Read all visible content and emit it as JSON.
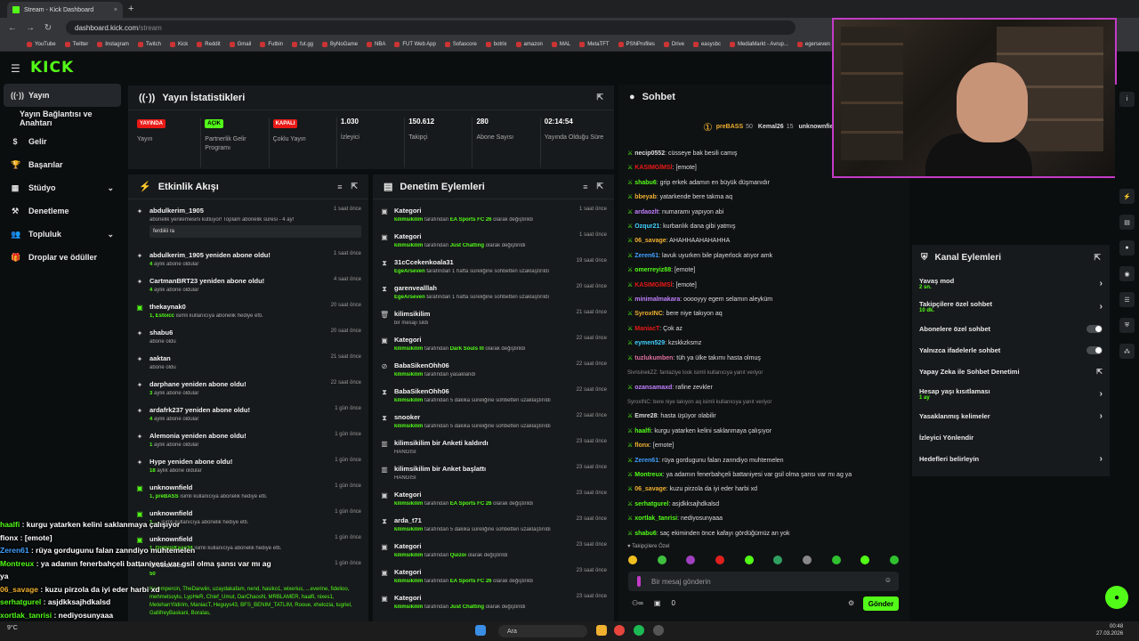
{
  "browser": {
    "tab_title": "Stream - Kick Dashboard",
    "new_tab": "+",
    "url_host": "dashboard.kick.com",
    "url_path": "/stream",
    "bookmarks": [
      "YouTube",
      "Twitter",
      "Instagram",
      "Twitch",
      "Kick",
      "Reddit",
      "Gmail",
      "Futbin",
      "fut.gg",
      "ByNoGame",
      "NBA",
      "FUT Web App",
      "Sofascore",
      "botrix",
      "amazon",
      "MAL",
      "MetaTFT",
      "PSNProfiles",
      "Drive",
      "easysbc",
      "MediaMarkt - Avrup...",
      "egerseven"
    ]
  },
  "brand": {
    "logo": "KICK",
    "accent": "#53fc18"
  },
  "leftnav": {
    "items": [
      {
        "label": "Yayın",
        "icon": "broadcast-icon"
      },
      {
        "label": "Yayın Bağlantısı ve Anahtarı"
      },
      {
        "label": "Gelir",
        "icon": "revenue-icon"
      },
      {
        "label": "Başarılar",
        "icon": "trophy-icon"
      },
      {
        "label": "Stüdyo",
        "icon": "studio-icon"
      },
      {
        "label": "Denetleme",
        "icon": "moderation-icon"
      },
      {
        "label": "Topluluk",
        "icon": "community-icon"
      },
      {
        "label": "Droplar ve ödüller",
        "icon": "gift-icon"
      }
    ]
  },
  "stats": {
    "title": "Yayın İstatistikleri",
    "cells": [
      {
        "badge": "YAYINDA",
        "label": "Yayın"
      },
      {
        "badge": "AÇIK",
        "label": "Partnerlik Gelir Programı"
      },
      {
        "badge": "KAPALI",
        "label": "Çoklu Yayın"
      },
      {
        "value": "1.030",
        "label": "İzleyici"
      },
      {
        "value": "150.612",
        "label": "Takipçi"
      },
      {
        "value": "280",
        "label": "Abone Sayısı"
      },
      {
        "value": "02:14:54",
        "label": "Yayında Olduğu Süre"
      }
    ]
  },
  "activity": {
    "title": "Etkinlik Akışı",
    "items": [
      {
        "title": "abdulkerim_1905",
        "time": "1 saat önce",
        "sub": "abonelik yenilemesini kutluyor! Toplam abonelik süresi - 4 ay!",
        "quote": "ferdiiiii ra"
      },
      {
        "title": "abdulkerim_1905 yeniden abone oldu!",
        "time": "1 saat önce",
        "subg": "4",
        "sub": " aylık abone oldular"
      },
      {
        "title": "CartmanBRT23 yeniden abone oldu!",
        "time": "4 saat önce",
        "subg": "4",
        "sub": " aylık abone oldular"
      },
      {
        "title": "thekaynak0",
        "time": "20 saat önce",
        "subg": "1, Estoicc",
        "sub": " isimli kullanıcıya abonelik hediye etti.",
        "gift": true
      },
      {
        "title": "shabu6",
        "time": "20 saat önce",
        "sub": "abone oldu"
      },
      {
        "title": "aaktan",
        "time": "21 saat önce",
        "sub": "abone oldu"
      },
      {
        "title": "darphane yeniden abone oldu!",
        "time": "22 saat önce",
        "subg": "3",
        "sub": " aylık abone oldular"
      },
      {
        "title": "ardafrk237 yeniden abone oldu!",
        "time": "1 gün önce",
        "subg": "4",
        "sub": " aylık abone oldular"
      },
      {
        "title": "Alemonia yeniden abone oldu!",
        "time": "1 gün önce",
        "subg": "1",
        "sub": " aylık abone oldular"
      },
      {
        "title": "Hype yeniden abone oldu!",
        "time": "1 gün önce",
        "subg": "18",
        "sub": " aylık abone oldular"
      },
      {
        "title": "unknownfield",
        "time": "1 gün önce",
        "subg": "1, preBASS",
        "sub": " isimli kullanıcıya abonelik hediye etti.",
        "gift": true
      },
      {
        "title": "unknownfield",
        "time": "1 gün önce",
        "subg": "1, ...",
        "sub": " isimli kullanıcıya abonelik hediye etti.",
        "gift": true
      },
      {
        "title": "unknownfield",
        "time": "1 gün önce",
        "subg": "1, GümüşKaan34",
        "sub": " isimli kullanıcıya abonelik hediye etti.",
        "gift": true
      },
      {
        "title": "ProBasser",
        "time": "1 gün önce",
        "subg": "50",
        "sub": ""
      }
    ],
    "gift_list": "Kerempercin, TheDarwiin, uzaydakafam, nend, hasiko1, wixerius, ...everine, fidelioo, mehmetsoylu, LypHeR, Chief_Umut, DarChaosN, MRBLAMER, haalfi, nixes1, MetehanYildirim, ManiacT, Heguys43, BFS_BENIM_TATLIM, Rooue, xhelozia, tugriel, GallifreyBaskani, Boralas,"
  },
  "moderation": {
    "title": "Denetim Eylemleri",
    "items": [
      {
        "icon": "category-icon",
        "title": "Kategori",
        "time": "1 saat önce",
        "mod": "kilimsikilim",
        "text": " tarafından ",
        "target": "EA Sports FC 26",
        "tail": " olarak değiştirildi"
      },
      {
        "icon": "category-icon",
        "title": "Kategori",
        "time": "1 saat önce",
        "mod": "kilimsikilim",
        "text": " tarafından ",
        "target": "Just Chatting",
        "tail": " olarak değiştirildi"
      },
      {
        "icon": "timeout-icon",
        "title": "31cCcekenkoala31",
        "time": "19 saat önce",
        "mod": "EgeArseven",
        "text": " tarafından 1 hafta süreliğine sohbetten uzaklaştırıldı"
      },
      {
        "icon": "timeout-icon",
        "title": "garenvealllah",
        "time": "20 saat önce",
        "mod": "EgeArseven",
        "text": " tarafından 1 hafta süreliğine sohbetten uzaklaştırıldı"
      },
      {
        "icon": "trash-icon",
        "title": "kilimsikilim",
        "time": "21 saat önce",
        "text": "bir mesajı sildi"
      },
      {
        "icon": "category-icon",
        "title": "Kategori",
        "time": "22 saat önce",
        "mod": "kilimsikilim",
        "text": " tarafından ",
        "target": "Dark Souls III",
        "tail": " olarak değiştirildi"
      },
      {
        "icon": "ban-icon",
        "title": "BabaSikenOhh06",
        "time": "22 saat önce",
        "mod": "kilimsikilim",
        "text": " tarafından yasaklandı"
      },
      {
        "icon": "timeout-icon",
        "title": "BabaSikenOhh06",
        "time": "22 saat önce",
        "mod": "kilimsikilim",
        "text": " tarafından 5 dakika süreliğine sohbetten uzaklaştırıldı"
      },
      {
        "icon": "timeout-icon",
        "title": "snooker",
        "time": "22 saat önce",
        "mod": "kilimsikilim",
        "text": " tarafından 5 dakika süreliğine sohbetten uzaklaştırıldı"
      },
      {
        "icon": "poll-icon",
        "title": "kilimsikilim bir Anketi kaldırdı",
        "time": "23 saat önce",
        "text": "HANGİSİ"
      },
      {
        "icon": "poll-icon",
        "title": "kilimsikilim bir Anket başlattı",
        "time": "23 saat önce",
        "text": "HANGİSİ"
      },
      {
        "icon": "category-icon",
        "title": "Kategori",
        "time": "23 saat önce",
        "mod": "kilimsikilim",
        "text": " tarafından ",
        "target": "EA Sports FC 26",
        "tail": " olarak değiştirildi"
      },
      {
        "icon": "timeout-icon",
        "title": "arda_t71",
        "time": "23 saat önce",
        "mod": "kilimsikilim",
        "text": " tarafından 5 dakika süreliğine sohbetten uzaklaştırıldı"
      },
      {
        "icon": "category-icon",
        "title": "Kategori",
        "time": "23 saat önce",
        "mod": "kilimsikilim",
        "text": " tarafından ",
        "target": "Quizoi",
        "tail": " olarak değiştirildi"
      },
      {
        "icon": "category-icon",
        "title": "Kategori",
        "time": "23 saat önce",
        "mod": "kilimsikilim",
        "text": " tarafından ",
        "target": "EA Sports FC 26",
        "tail": " olarak değiştirildi"
      },
      {
        "icon": "category-icon",
        "title": "Kategori",
        "time": "23 saat önce",
        "mod": "kilimsikilim",
        "text": " tarafından ",
        "target": "Just Chatting",
        "tail": " olarak değiştirildi"
      }
    ]
  },
  "chat": {
    "title": "Sohbet",
    "pinned": [
      {
        "name": "preBASS",
        "count": "50"
      },
      {
        "name": "Kemal26",
        "count": "15"
      },
      {
        "name": "unknownfield",
        "count": "5"
      }
    ],
    "messages": [
      {
        "user": "necip0552",
        "color": "#ddd",
        "text": "cüsseye bak besili camış"
      },
      {
        "user": "KASIMGİMSİ",
        "color": "#e91916",
        "text": "[emote]"
      },
      {
        "user": "shabu6",
        "color": "#53fc18",
        "text": "grip erkek adamın en büyük düşmanıdır"
      },
      {
        "user": "bbeyab",
        "color": "#f0b030",
        "text": "yatarkende bere takma aq"
      },
      {
        "user": "ardaozlt",
        "color": "#c080ff",
        "text": "numaramı yapıyon abi"
      },
      {
        "user": "Ozqur21",
        "color": "#40d0ff",
        "text": "kurbanlık dana gibi yatmış"
      },
      {
        "user": "06_savage",
        "color": "#f0b030",
        "text": "AHAHHAAHAHAHHA"
      },
      {
        "user": "Zeren61",
        "color": "#40a0ff",
        "text": "lavuk uyurken bile playerlock atıyor amk"
      },
      {
        "user": "omerreyiz88",
        "color": "#53fc18",
        "text": "[emote]"
      },
      {
        "user": "KASIMGİMSİ",
        "color": "#e91916",
        "text": "[emote]"
      },
      {
        "user": "minimalmakara",
        "color": "#c080ff",
        "text": "ooooyyy egem selamın aleyküm"
      },
      {
        "user": "SyroxINC",
        "color": "#f0b030",
        "text": "bere niye takıyon aq"
      },
      {
        "user": "ManiacT",
        "color": "#e91916",
        "text": "Çok az"
      },
      {
        "user": "eymen529",
        "color": "#40d0ff",
        "text": "kzskkzksmz"
      },
      {
        "user": "tuzlukumben",
        "color": "#e070a0",
        "text": "tüh ya ülke takımı hasta olmuş"
      },
      {
        "user": "",
        "color": "#888",
        "text": "SivrisinekZZ: fantaziye look isimli kullanıcıya yanıt veriyor",
        "sys": true
      },
      {
        "user": "ozansamaxd",
        "color": "#c080ff",
        "text": "rafine zevkler"
      },
      {
        "user": "",
        "color": "#888",
        "text": "SyroxINC: bere niye takıyon aq isimli kullanıcıya yanıt veriyor",
        "sys": true
      },
      {
        "user": "Emre28",
        "color": "#ddd",
        "text": "hasta üşüyor olabilir"
      },
      {
        "user": "haalfi",
        "color": "#53fc18",
        "text": "kurgu yatarken kelini saklanmaya çalışıyor"
      },
      {
        "user": "flonx",
        "color": "#f0b030",
        "text": "[emote]"
      },
      {
        "user": "Zeren61",
        "color": "#40a0ff",
        "text": "rüya gordugunu falan zanndiyo muhtemelen"
      },
      {
        "user": "Montreux",
        "color": "#53fc18",
        "text": "ya adamın fenerbahçeli battaniyesi var gsil olma şansı var mı ag ya"
      },
      {
        "user": "06_savage",
        "color": "#f0b030",
        "text": "kuzu pirzola da iyi eder harbi xd"
      },
      {
        "user": "serhatgurel",
        "color": "#53fc18",
        "text": "asjdkksajhdkalsd"
      },
      {
        "user": "xortlak_tanrisi",
        "color": "#53fc18",
        "text": "nediyosunyaaa"
      },
      {
        "user": "shabu6",
        "color": "#53fc18",
        "text": "saç ekiminden önce kafayı gördüğümüz an yok"
      }
    ],
    "followers_only": "Takipçilere Özel",
    "input_placeholder": "Bir mesaj gönderin",
    "send_label": "Gönder",
    "counter": "0"
  },
  "channel_actions": {
    "title": "Kanal Eylemleri",
    "rows": [
      {
        "label": "Yavaş mod",
        "sub": "2 sn.",
        "type": "chevron"
      },
      {
        "label": "Takipçilere özel sohbet",
        "sub": "10 dk.",
        "type": "chevron"
      },
      {
        "label": "Abonelere özel sohbet",
        "type": "toggle"
      },
      {
        "label": "Yalnızca ifadelerle sohbet",
        "type": "toggle"
      },
      {
        "label": "Yapay Zeka ile Sohbet Denetimi",
        "type": "external"
      },
      {
        "label": "Hesap yaşı kısıtlaması",
        "sub": "1 ay",
        "type": "chevron"
      },
      {
        "label": "Yasaklanmış kelimeler",
        "type": "chevron"
      },
      {
        "label": "İzleyici Yönlendir",
        "type": "none"
      },
      {
        "label": "Hedefleri belirleyin",
        "type": "chevron"
      }
    ]
  },
  "overlay_chat": [
    {
      "user": "haalfi",
      "text": " : kurgu yatarken kelini saklanmaya çalışıyor",
      "color": "#53fc18"
    },
    {
      "user": "flonx",
      "text": " : [emote]",
      "color": "#fff"
    },
    {
      "user": "Zeren61",
      "text": " : rüya gordugunu falan zanndiyo muhtemelen",
      "color": "#40a0ff"
    },
    {
      "user": "Montreux",
      "text": " : ya adamın fenerbahçeli battaniyesi var gsil olma şansı var mı ag",
      "color": "#53fc18"
    },
    {
      "user": "",
      "text": "ya",
      "color": "#fff"
    },
    {
      "user": "06_savage",
      "text": " : kuzu pirzola da iyi eder harbi xd",
      "color": "#f0b030"
    },
    {
      "user": "serhatgurel",
      "text": " : asjdkksajhdkalsd",
      "color": "#53fc18"
    },
    {
      "user": "xortlak_tanrisi",
      "text": " : nediyosunyaaa",
      "color": "#53fc18"
    },
    {
      "user": "shabu6",
      "text": " : saç ekiminden önce kafayı gördüğümüz an yok",
      "color": "#53fc18"
    }
  ],
  "taskbar": {
    "search": "Ara",
    "time": "00:48",
    "date": "27.03.2026",
    "weather": "9°C"
  }
}
